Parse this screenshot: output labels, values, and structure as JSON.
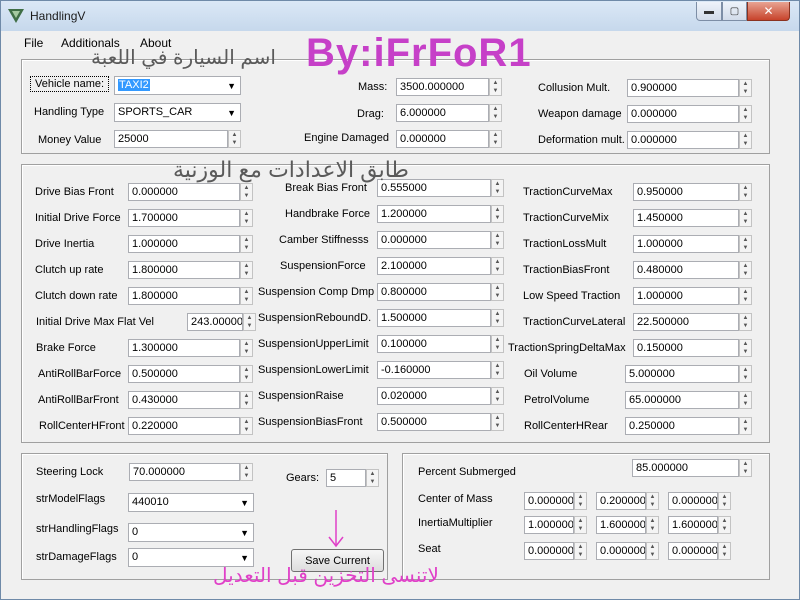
{
  "window": {
    "title": "HandlingV",
    "controls": {
      "minimize": "▬",
      "maximize": "▢",
      "close": "✕"
    }
  },
  "menu": [
    {
      "id": "file",
      "label": "File"
    },
    {
      "id": "additionals",
      "label": "Additionals"
    },
    {
      "id": "about",
      "label": "About"
    }
  ],
  "annotations": {
    "author": "By:iFrFoR1",
    "vehicle_name_hint": "اسم السيارة في اللعبة",
    "apply_hint": "طابق الاعدادات مع الوزنية",
    "save_hint": "لاتنسى التخزين قبل التعديل",
    "arrow_glyph": "↓"
  },
  "general": {
    "vehicle_name": {
      "label": "Vehicle name:",
      "value": "TAXI2"
    },
    "handling_type": {
      "label": "Handling Type",
      "value": "SPORTS_CAR"
    },
    "money_value": {
      "label": "Money Value",
      "value": "25000"
    },
    "mass": {
      "label": "Mass:",
      "value": "3500.000000"
    },
    "drag": {
      "label": "Drag:",
      "value": "6.000000"
    },
    "engine_damaged": {
      "label": "Engine Damaged",
      "value": "0.000000"
    },
    "collusion_mult": {
      "label": "Collusion Mult.",
      "value": "0.900000"
    },
    "weapon_damage": {
      "label": "Weapon damage",
      "value": "0.000000"
    },
    "deformation_mult": {
      "label": "Deformation mult.",
      "value": "0.000000"
    }
  },
  "physics": {
    "col1": [
      {
        "label": "Drive Bias Front",
        "value": "0.000000"
      },
      {
        "label": "Initial Drive Force",
        "value": "1.700000"
      },
      {
        "label": "Drive Inertia",
        "value": "1.000000"
      },
      {
        "label": "Clutch up rate",
        "value": "1.800000"
      },
      {
        "label": "Clutch down rate",
        "value": "1.800000"
      },
      {
        "label": "Initial Drive Max Flat Vel",
        "value": "243.000000"
      },
      {
        "label": "Brake Force",
        "value": "1.300000"
      },
      {
        "label": "AntiRollBarForce",
        "value": "0.500000"
      },
      {
        "label": "AntiRollBarFront",
        "value": "0.430000"
      },
      {
        "label": "RollCenterHFront",
        "value": "0.220000"
      }
    ],
    "col2": [
      {
        "label": "Break Bias Front",
        "value": "0.555000"
      },
      {
        "label": "Handbrake Force",
        "value": "1.200000"
      },
      {
        "label": "Camber Stiffnesss",
        "value": "0.000000"
      },
      {
        "label": "SuspensionForce",
        "value": "2.100000"
      },
      {
        "label": "Suspension Comp Dmp",
        "value": "0.800000"
      },
      {
        "label": "SuspensionReboundD.",
        "value": "1.500000"
      },
      {
        "label": "SuspensionUpperLimit",
        "value": "0.100000"
      },
      {
        "label": "SuspensionLowerLimit",
        "value": "-0.160000"
      },
      {
        "label": "SuspensionRaise",
        "value": "0.020000"
      },
      {
        "label": "SuspensionBiasFront",
        "value": "0.500000"
      }
    ],
    "col3": [
      {
        "label": "TractionCurveMax",
        "value": "0.950000"
      },
      {
        "label": "TractionCurveMix",
        "value": "1.450000"
      },
      {
        "label": "TractionLossMult",
        "value": "1.000000"
      },
      {
        "label": "TractionBiasFront",
        "value": "0.480000"
      },
      {
        "label": "Low Speed Traction",
        "value": "1.000000"
      },
      {
        "label": "TractionCurveLateral",
        "value": "22.500000"
      },
      {
        "label": "TractionSpringDeltaMax",
        "value": "0.150000"
      },
      {
        "label": "Oil Volume",
        "value": "5.000000"
      },
      {
        "label": "PetrolVolume",
        "value": "65.000000"
      },
      {
        "label": "RollCenterHRear",
        "value": "0.250000"
      }
    ]
  },
  "bottom_left": {
    "steering_lock": {
      "label": "Steering Lock",
      "value": "70.000000"
    },
    "gears": {
      "label": "Gears:",
      "value": "5"
    },
    "model_flags": {
      "label": "strModelFlags",
      "value": "440010"
    },
    "handling_flags": {
      "label": "strHandlingFlags",
      "value": "0"
    },
    "damage_flags": {
      "label": "strDamageFlags",
      "value": "0"
    },
    "save_button": "Save Current"
  },
  "bottom_right": {
    "percent_submerged": {
      "label": "Percent Submerged",
      "value": "85.000000"
    },
    "center_of_mass": {
      "label": "Center of Mass",
      "values": [
        "0.000000",
        "0.200000",
        "0.000000"
      ]
    },
    "inertia_multiplier": {
      "label": "InertiaMultiplier",
      "values": [
        "1.000000",
        "1.600000",
        "1.600000"
      ]
    },
    "seat": {
      "label": "Seat",
      "values": [
        "0.000000",
        "0.000000",
        "0.000000"
      ]
    }
  }
}
